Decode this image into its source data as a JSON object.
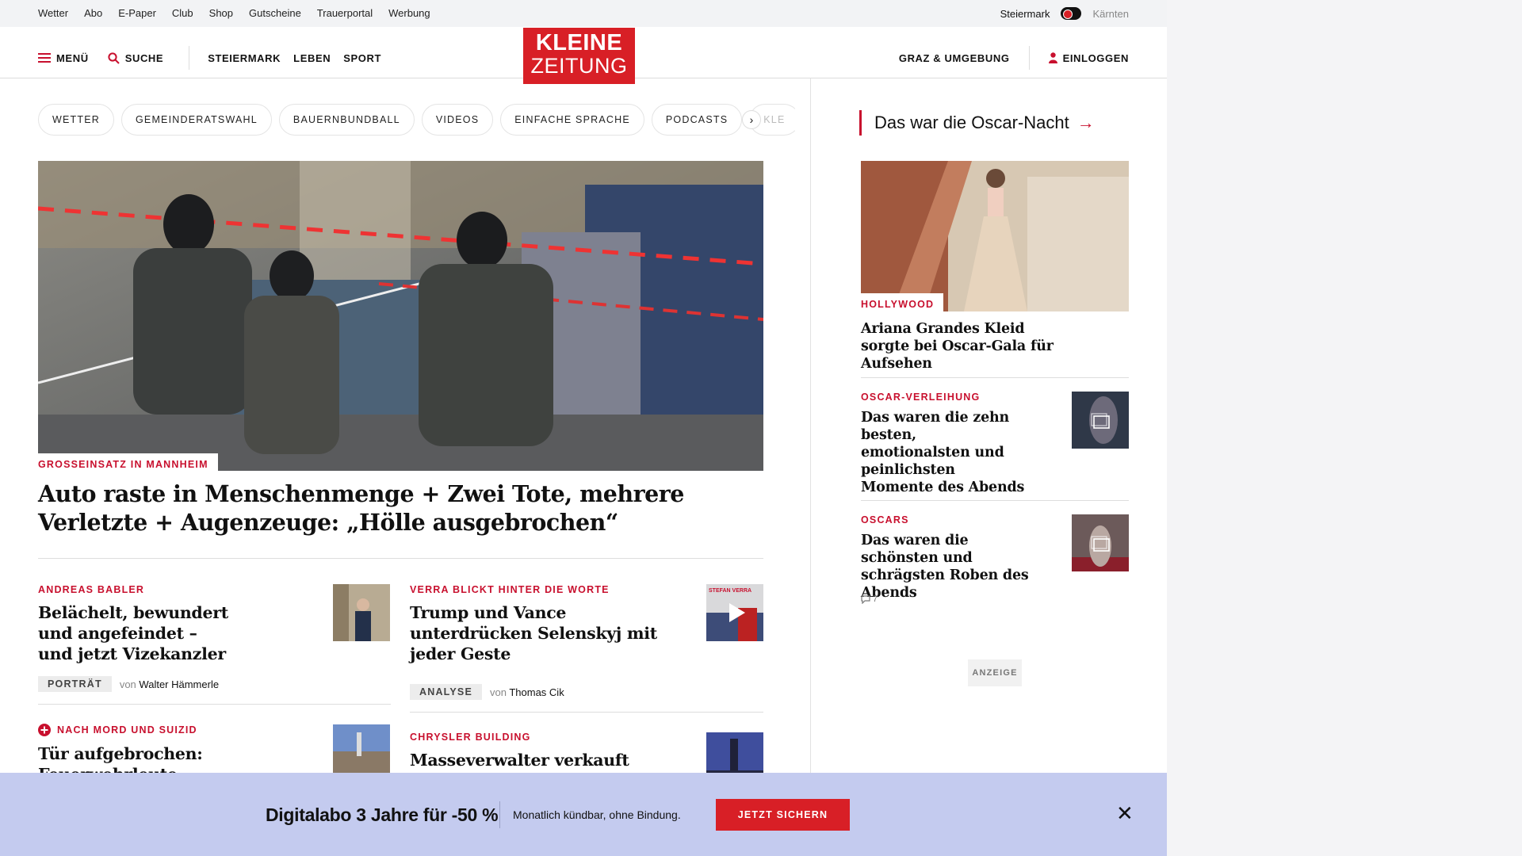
{
  "topbar": {
    "links": [
      "Wetter",
      "Abo",
      "E-Paper",
      "Club",
      "Shop",
      "Gutscheine",
      "Trauerportal",
      "Werbung"
    ],
    "region_active": "Steiermark",
    "region_other": "Kärnten"
  },
  "header": {
    "menu_label": "MENÜ",
    "search_label": "SUCHE",
    "nav": [
      "STEIERMARK",
      "LEBEN",
      "SPORT"
    ],
    "logo_line1": "KLEINE",
    "logo_line2": "ZEITUNG",
    "local_label": "GRAZ & UMGEBUNG",
    "login_label": "EINLOGGEN"
  },
  "pills": [
    "WETTER",
    "GEMEINDERATSWAHL",
    "BAUERNBUNDBALL",
    "VIDEOS",
    "EINFACHE SPRACHE",
    "PODCASTS",
    "KLE"
  ],
  "hero": {
    "kicker": "GROSSEINSATZ IN MANNHEIM",
    "title": "Auto raste in Menschenmenge + Zwei Tote, mehrere Verletzte + Augenzeuge: „Hölle ausgebrochen“"
  },
  "articles": [
    {
      "kicker": "ANDREAS BABLER",
      "title": "Belächelt, bewundert und angefeindet – und jetzt Vizekanzler",
      "badge": "PORTRÄT",
      "von": "von",
      "author": "Walter Hämmerle"
    },
    {
      "kicker": "VERRA BLICKT HINTER DIE WORTE",
      "title": "Trump und Vance unterdrücken Selenskyj mit jeder Geste",
      "badge": "ANALYSE",
      "von": "von",
      "author": "Thomas Cik",
      "thumb_text": "STEFAN VERRA"
    },
    {
      "kicker": "NACH MORD UND SUIZID",
      "title": "Tür aufgebrochen: Feuerwehrleute entdeckten"
    },
    {
      "kicker": "CHRYSLER BUILDING",
      "title": "Masseverwalter verkauft"
    }
  ],
  "right": {
    "section_title": "Das war die Oscar-Nacht",
    "items": [
      {
        "kicker": "HOLLYWOOD",
        "title": "Ariana Grandes Kleid sorgte bei Oscar-Gala für Aufsehen"
      },
      {
        "kicker": "OSCAR-VERLEIHUNG",
        "title": "Das waren die zehn besten, emotionalsten und peinlichsten Momente des Abends"
      },
      {
        "kicker": "OSCARS",
        "title": "Das waren die schönsten und schrägsten Roben des Abends",
        "comments": "7"
      }
    ],
    "ad_label": "ANZEIGE"
  },
  "banner": {
    "title": "Digitalabo 3 Jahre für -50 %",
    "subtitle": "Monatlich kündbar, ohne Bindung.",
    "cta": "JETZT SICHERN"
  },
  "colors": {
    "brand_red": "#d81f26",
    "kicker_red": "#c8102e",
    "banner_bg": "#c4cbef"
  }
}
